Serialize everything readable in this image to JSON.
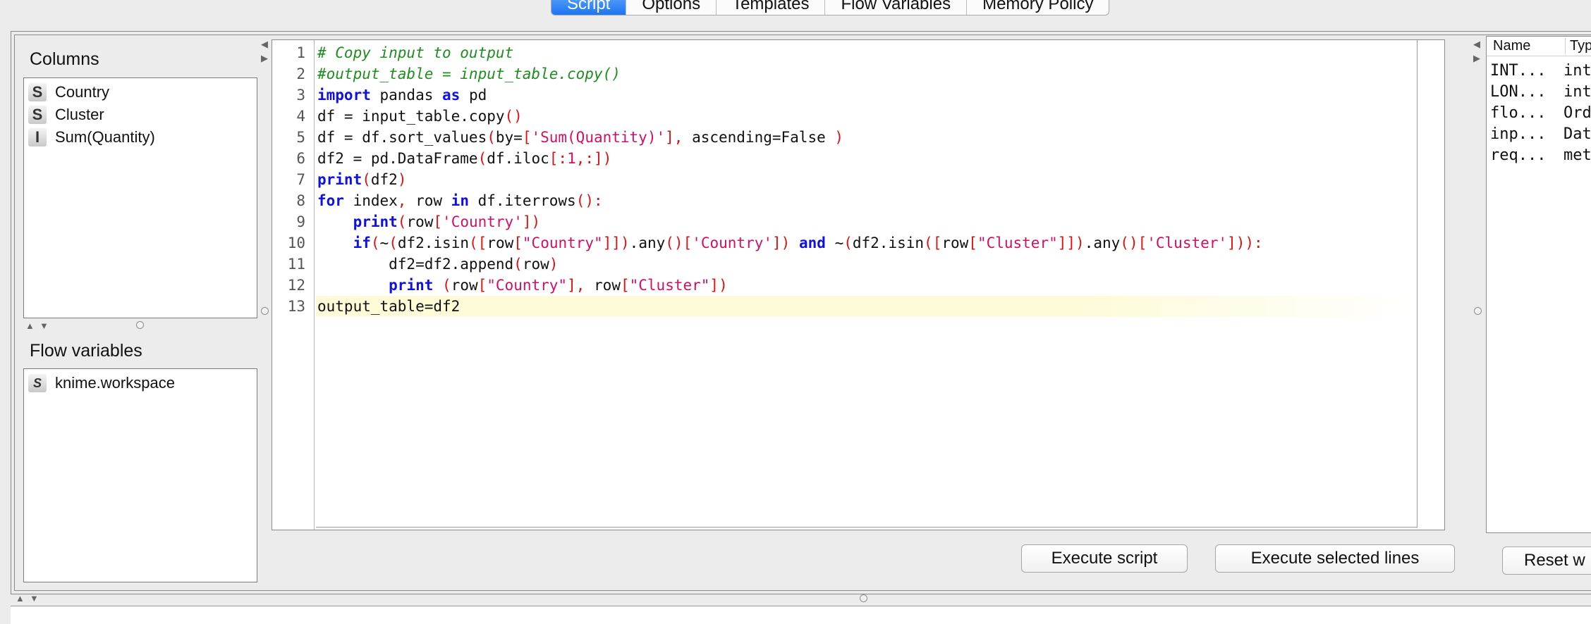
{
  "tabs": [
    "Script",
    "Options",
    "Templates",
    "Flow Variables",
    "Memory Policy"
  ],
  "columns_panel": {
    "title": "Columns",
    "items": [
      {
        "type": "S",
        "name": "Country"
      },
      {
        "type": "S",
        "name": "Cluster"
      },
      {
        "type": "I",
        "name": "Sum(Quantity)"
      }
    ]
  },
  "flow_panel": {
    "title": "Flow variables",
    "items": [
      {
        "type": "S",
        "name": "knime.workspace"
      }
    ]
  },
  "editor": {
    "line_numbers": [
      "1",
      "2",
      "3",
      "4",
      "5",
      "6",
      "7",
      "8",
      "9",
      "10",
      "11",
      "12",
      "13"
    ],
    "lines": [
      "# Copy input to output",
      "#output_table = input_table.copy()",
      "import pandas as pd",
      "df = input_table.copy()",
      "df = df.sort_values(by=['Sum(Quantity)'], ascending=False )",
      "df2 = pd.DataFrame(df.iloc[:1,:])",
      "print(df2)",
      "for index, row in df.iterrows():",
      "    print(row['Country'])",
      "    if(~(df2.isin([row[\"Country\"]]).any()['Country']) and ~(df2.isin([row[\"Cluster\"]]).any()['Cluster'])):",
      "        df2=df2.append(row)",
      "        print (row[\"Country\"], row[\"Cluster\"])",
      "output_table=df2"
    ],
    "highlighted_line": 13
  },
  "buttons": {
    "execute_script": "Execute script",
    "execute_selected": "Execute selected lines",
    "reset": "Reset w"
  },
  "workspace_table": {
    "headers": [
      "Name",
      "Typ"
    ],
    "rows": [
      {
        "name": "INT...",
        "type": "int"
      },
      {
        "name": "LON...",
        "type": "int"
      },
      {
        "name": "flo...",
        "type": "Ord"
      },
      {
        "name": "inp...",
        "type": "Dat"
      },
      {
        "name": "req...",
        "type": "met"
      }
    ]
  },
  "colors": {
    "tab_active": "#1a72f2",
    "comment": "#1e8e1e",
    "keyword": "#1010e0",
    "string": "#d21060",
    "paren": "#e01010",
    "line_highlight": "#fdfbd8"
  }
}
